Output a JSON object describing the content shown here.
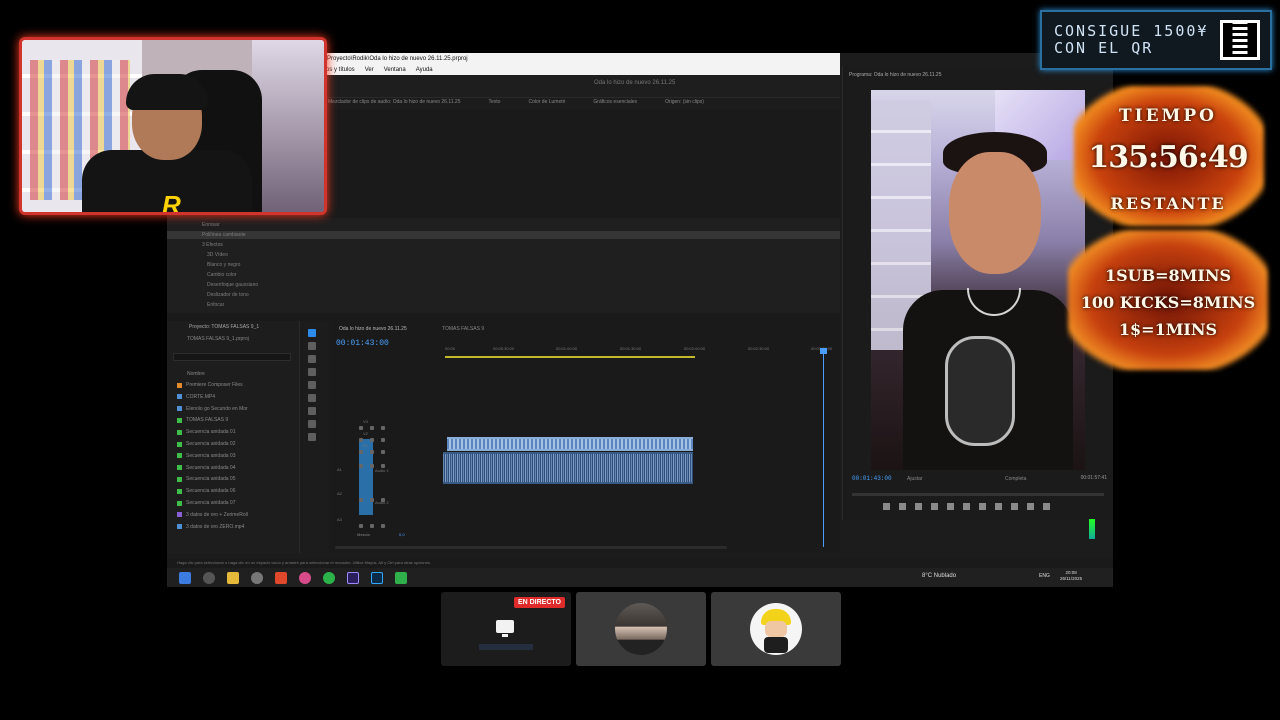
{
  "premiere": {
    "title": "Proyecto\\Rodik\\Oda lo hizo de nuevo 26.11.25.prproj",
    "menu": [
      "os y títulos",
      "Ver",
      "Ventana",
      "Ayuda"
    ],
    "sequence_header": "Oda lo hizo de nuevo 26.11.25",
    "source_tabs": [
      "Mezclador de clips de audio: Oda lo hizo de nuevo 26.11.25",
      "Texto",
      "Color de Lumetri",
      "Gráficos esenciales",
      "Origen: (sin clips)"
    ],
    "effects_items": [
      "Enrosar",
      "Polilínea cambiante",
      "3 Efectos",
      "3D Vídeo",
      "Blanco y negro",
      "Cambio color",
      "Desenfoque gaussiano",
      "Deslizador de tono",
      "Enfocar"
    ],
    "project": {
      "tab": "Proyecto: TOMAS FALSAS 9_1",
      "file": "TOMAS FALSAS 9_1.prproj",
      "header": "Nombre",
      "items": [
        {
          "name": "Premiere Composer Files",
          "color": "#e58a2a"
        },
        {
          "name": "CORTE.MP4",
          "color": "#4f8fd6"
        },
        {
          "name": "Elenolo go Secundo en Mor",
          "color": "#4f8fd6"
        },
        {
          "name": "TOMAS FALSAS 9",
          "color": "#3fbf4a"
        },
        {
          "name": "Secuencia anidada 01",
          "color": "#3fbf4a"
        },
        {
          "name": "Secuencia anidada 02",
          "color": "#3fbf4a"
        },
        {
          "name": "Secuencia anidada 03",
          "color": "#3fbf4a"
        },
        {
          "name": "Secuencia anidada 04",
          "color": "#3fbf4a"
        },
        {
          "name": "Secuencia anidada 05",
          "color": "#3fbf4a"
        },
        {
          "name": "Secuencia anidada 06",
          "color": "#3fbf4a"
        },
        {
          "name": "Secuencia anidada 07",
          "color": "#3fbf4a"
        },
        {
          "name": "3 datos de oro + ZerimeRoll",
          "color": "#8a5fd6"
        },
        {
          "name": "3 datos de oro ZERO.mp4",
          "color": "#4f8fd6"
        }
      ]
    },
    "timeline": {
      "tabs": [
        "Oda lo hizo de nuevo 26.11.25",
        "TOMAS FALSAS 9"
      ],
      "timecode": "00:01:43:00",
      "ruler": [
        "00:00",
        "00:00:30:00",
        "00:01:00:00",
        "00:01:30:00",
        "00:02:00:00",
        "00:02:30:00",
        "00:03:00:00"
      ],
      "tracks": [
        "V3",
        "V2",
        "V1",
        "A1",
        "A2",
        "A3"
      ],
      "audio_label_1": "Audio 1",
      "audio_label_2": "Audio 2",
      "mix_label": "Mezcla",
      "mix_value": "0,0"
    },
    "program": {
      "title": "Programa: Oda lo hizo de nuevo 26.11.25",
      "timecode": "00:01:43:00",
      "fit": "Ajustar",
      "quality": "Completa",
      "duration": "00:01:57:41"
    },
    "status": "Haga clic para seleccionar o haga clic en un espacio vacío y arrastre para seleccionar el recuadro. Utilice Mayús, Alt y Ctrl para otras opciones.",
    "taskbar": {
      "weather": "8°C  Nublado",
      "lang": "ENG",
      "time": "20:08",
      "date": "26/11/2025"
    }
  },
  "qr_banner": {
    "line1": "CONSIGUE 1500¥",
    "line2": "CON EL QR"
  },
  "timer": {
    "title": "TIEMPO",
    "time": "135:56:49",
    "subtitle": "RESTANTE",
    "rules": [
      "1SUB=8MINS",
      "100 KICKS=8MINS",
      "1$=1MINS"
    ]
  },
  "call": {
    "live_badge": "EN DIRECTO"
  },
  "colors": {
    "accent_blue": "#4a9dfd",
    "live_red": "#e02b2b",
    "webcam_border": "#d0342c"
  }
}
